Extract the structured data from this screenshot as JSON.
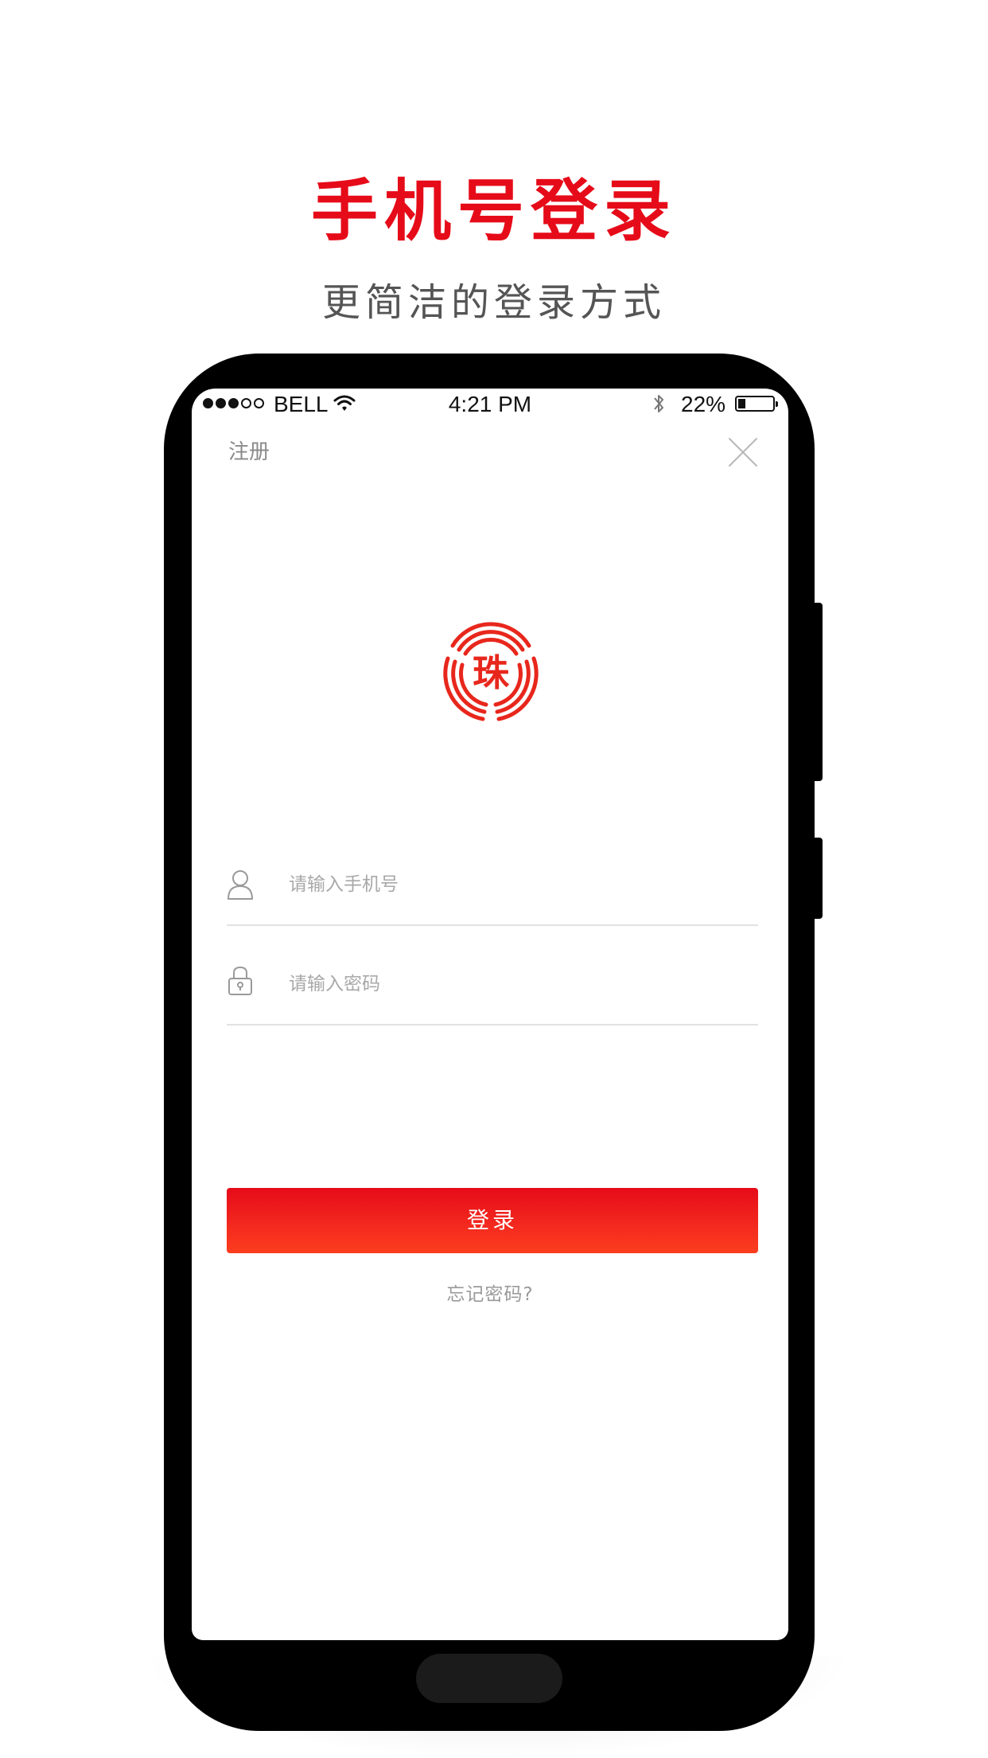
{
  "promo": {
    "title": "手机号登录",
    "subtitle": "更简洁的登录方式"
  },
  "status_bar": {
    "signal_bars_filled": 3,
    "signal_bars_total": 5,
    "carrier": "BELL",
    "time": "4:21 PM",
    "battery_percent_label": "22%",
    "battery_level": 0.22
  },
  "nav": {
    "register_label": "注册",
    "close_icon": "close-icon"
  },
  "logo": {
    "character": "珠"
  },
  "form": {
    "phone_placeholder": "请输入手机号",
    "phone_value": "",
    "password_placeholder": "请输入密码",
    "password_value": "",
    "user_icon": "user-icon",
    "lock_icon": "lock-icon"
  },
  "actions": {
    "login_label": "登录",
    "forgot_label": "忘记密码?"
  },
  "colors": {
    "brand_red": "#e60b19",
    "button_gradient_bottom": "#fb3e1f",
    "muted_text": "#8a8a8a",
    "divider": "#e2e2e2"
  }
}
